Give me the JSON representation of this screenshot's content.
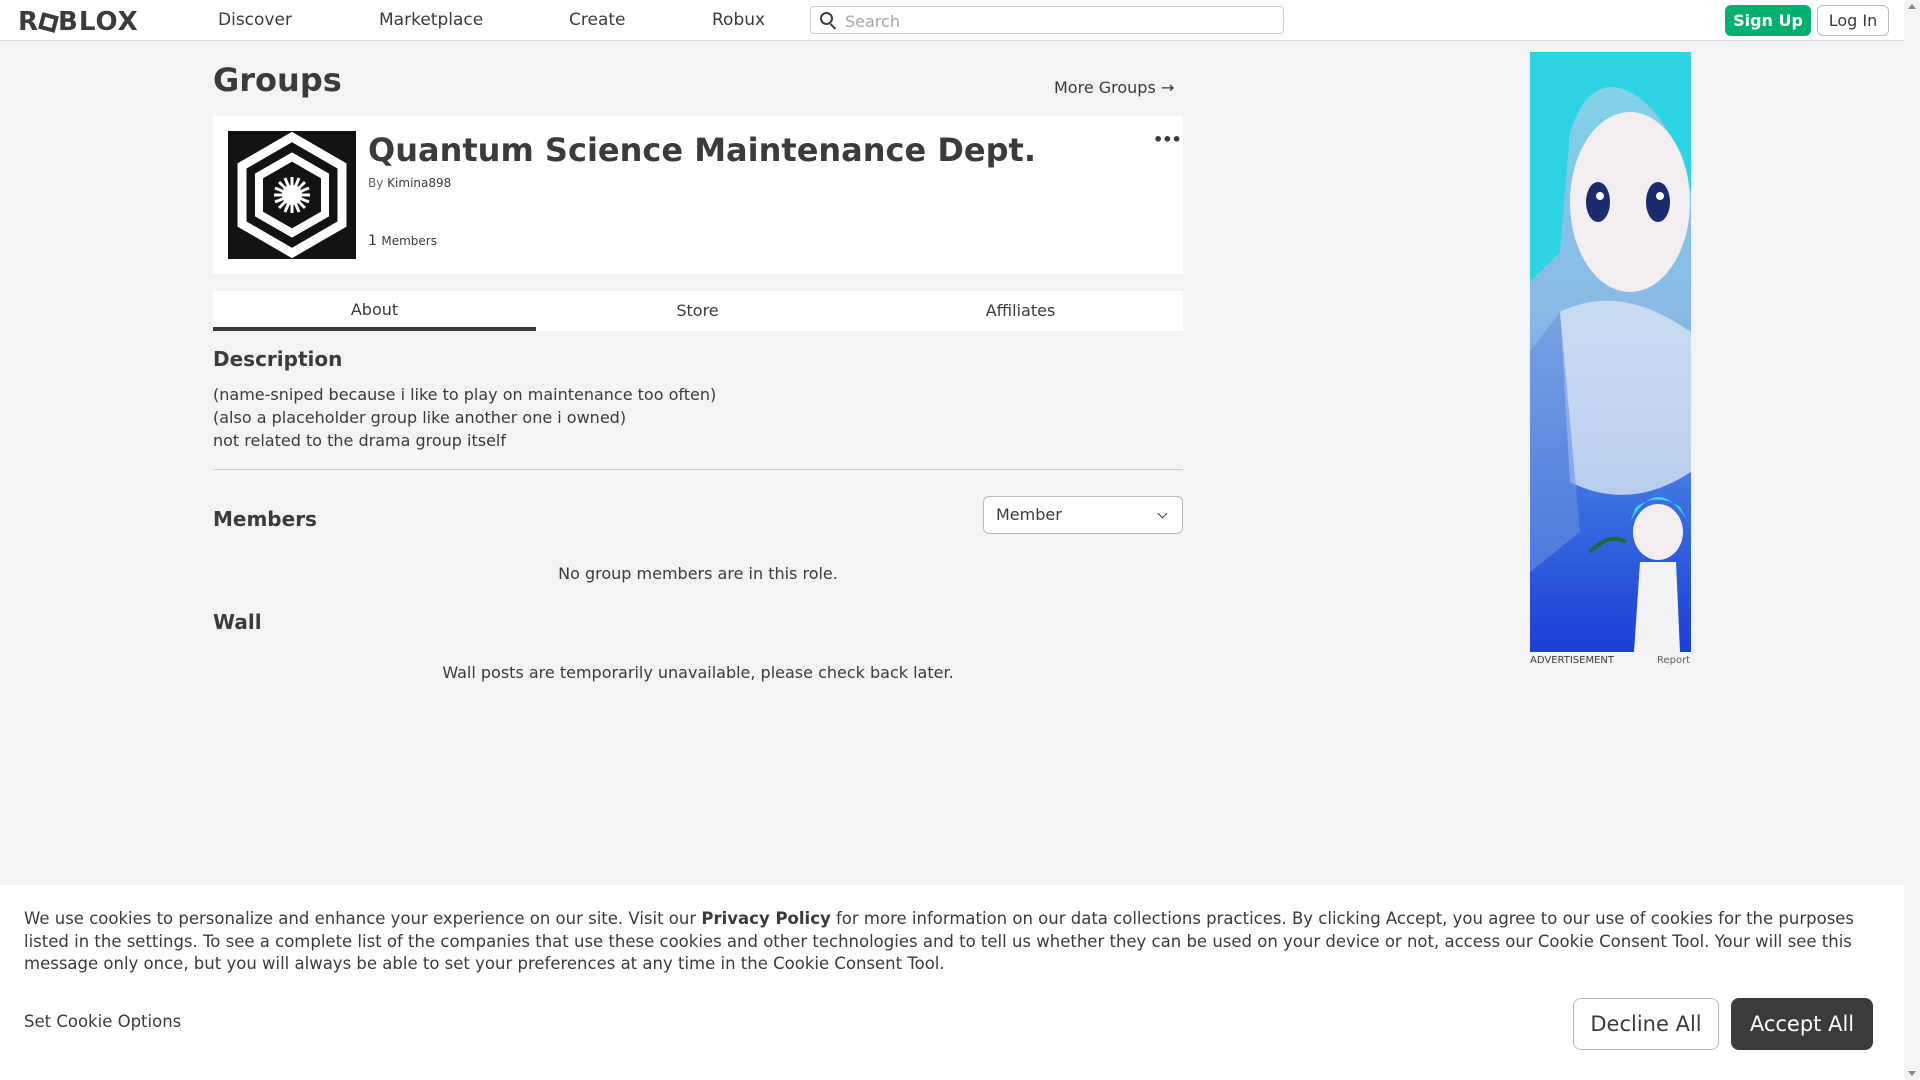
{
  "nav": {
    "logo": "ROBLOX",
    "links": [
      "Discover",
      "Marketplace",
      "Create",
      "Robux"
    ],
    "search_placeholder": "Search",
    "signup": "Sign Up",
    "login": "Log In"
  },
  "page": {
    "title": "Groups",
    "more_groups": "More Groups →"
  },
  "group": {
    "name": "Quantum Science Maintenance Dept.",
    "by_label": "By",
    "owner": "Kimina898",
    "member_count": "1",
    "member_label": "Members",
    "more_menu": "•••"
  },
  "tabs": [
    "About",
    "Store",
    "Affiliates"
  ],
  "about": {
    "description_heading": "Description",
    "description_lines": [
      "(name-sniped because i like to play on maintenance too often)",
      "(also a placeholder group like another one i owned)",
      "not related to the drama group itself"
    ],
    "members_heading": "Members",
    "role_selected": "Member",
    "members_empty": "No group members are in this role.",
    "wall_heading": "Wall",
    "wall_empty": "Wall posts are temporarily unavailable, please check back later."
  },
  "ad": {
    "label": "ADVERTISEMENT",
    "report": "Report"
  },
  "cookie": {
    "text_before": "We use cookies to personalize and enhance your experience on our site. Visit our ",
    "privacy_link": "Privacy Policy",
    "text_after": " for more information on our data collections practices. By clicking Accept, you agree to our use of cookies for the purposes listed in the settings. To see a complete list of the companies that use these cookies and other technologies and to tell us whether they can be used on your device or not, access our Cookie Consent Tool. Your will see this message only once, but you will always be able to set your preferences at any time in the Cookie Consent Tool.",
    "options": "Set Cookie Options",
    "decline": "Decline All",
    "accept": "Accept All"
  },
  "colors": {
    "signup_green": "#00b06f",
    "accept_dark": "#393b3d",
    "page_bg": "#f2f4f5"
  }
}
